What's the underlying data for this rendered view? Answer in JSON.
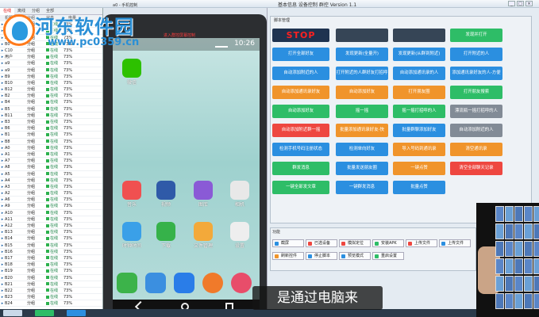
{
  "window": {
    "title": "基本信息  设备控制  群控  Version 1.1"
  },
  "watermark": {
    "title": "河东软件园",
    "url": "www.pc0359.cn"
  },
  "left": {
    "tabs": [
      "在线",
      "离线",
      "分组",
      "全部"
    ],
    "headers": [
      "",
      "机器名",
      "分组",
      "状态",
      "电量"
    ],
    "rows": [
      {
        "name": "a0",
        "group": "分组",
        "status": "在线",
        "batt": "73%"
      },
      {
        "name": "a9",
        "group": "分组",
        "status": "在线",
        "batt": "73%"
      },
      {
        "name": "a9",
        "group": "分组",
        "status": "在线",
        "batt": "73%"
      },
      {
        "name": "B0",
        "group": "分组",
        "status": "在线",
        "batt": "73%"
      },
      {
        "name": "C10",
        "group": "分组",
        "status": "在线",
        "batt": "73%"
      },
      {
        "name": "用户",
        "group": "分组",
        "status": "在线",
        "batt": "73%"
      },
      {
        "name": "a9",
        "group": "分组",
        "status": "在线",
        "batt": "73%"
      },
      {
        "name": "a9",
        "group": "分组",
        "status": "在线",
        "batt": "73%"
      },
      {
        "name": "B9",
        "group": "分组",
        "status": "在线",
        "batt": "73%"
      },
      {
        "name": "B10",
        "group": "分组",
        "status": "在线",
        "batt": "73%"
      },
      {
        "name": "B12",
        "group": "分组",
        "status": "在线",
        "batt": "73%"
      },
      {
        "name": "B2",
        "group": "分组",
        "status": "在线",
        "batt": "73%"
      },
      {
        "name": "B4",
        "group": "分组",
        "status": "在线",
        "batt": "73%"
      },
      {
        "name": "B5",
        "group": "分组",
        "status": "在线",
        "batt": "73%"
      },
      {
        "name": "B11",
        "group": "分组",
        "status": "在线",
        "batt": "73%"
      },
      {
        "name": "B3",
        "group": "分组",
        "status": "在线",
        "batt": "73%"
      },
      {
        "name": "B6",
        "group": "分组",
        "status": "在线",
        "batt": "73%"
      },
      {
        "name": "B1",
        "group": "分组",
        "status": "在线",
        "batt": "73%"
      },
      {
        "name": "B8",
        "group": "分组",
        "status": "在线",
        "batt": "73%"
      },
      {
        "name": "A0",
        "group": "分组",
        "status": "在线",
        "batt": "73%"
      },
      {
        "name": "A1",
        "group": "分组",
        "status": "在线",
        "batt": "73%"
      },
      {
        "name": "A7",
        "group": "分组",
        "status": "在线",
        "batt": "73%"
      },
      {
        "name": "A8",
        "group": "分组",
        "status": "在线",
        "batt": "73%"
      },
      {
        "name": "A5",
        "group": "分组",
        "status": "在线",
        "batt": "73%"
      },
      {
        "name": "A4",
        "group": "分组",
        "status": "在线",
        "batt": "73%"
      },
      {
        "name": "A3",
        "group": "分组",
        "status": "在线",
        "batt": "73%"
      },
      {
        "name": "A2",
        "group": "分组",
        "status": "在线",
        "batt": "73%"
      },
      {
        "name": "A6",
        "group": "分组",
        "status": "在线",
        "batt": "73%"
      },
      {
        "name": "A9",
        "group": "分组",
        "status": "在线",
        "batt": "73%"
      },
      {
        "name": "A10",
        "group": "分组",
        "status": "在线",
        "batt": "73%"
      },
      {
        "name": "A11",
        "group": "分组",
        "status": "在线",
        "batt": "73%"
      },
      {
        "name": "A12",
        "group": "分组",
        "status": "在线",
        "batt": "73%"
      },
      {
        "name": "B13",
        "group": "分组",
        "status": "在线",
        "batt": "73%"
      },
      {
        "name": "B14",
        "group": "分组",
        "status": "在线",
        "batt": "73%"
      },
      {
        "name": "B15",
        "group": "分组",
        "status": "在线",
        "batt": "73%"
      },
      {
        "name": "B16",
        "group": "分组",
        "status": "在线",
        "batt": "73%"
      },
      {
        "name": "B17",
        "group": "分组",
        "status": "在线",
        "batt": "73%"
      },
      {
        "name": "B18",
        "group": "分组",
        "status": "在线",
        "batt": "73%"
      },
      {
        "name": "B19",
        "group": "分组",
        "status": "在线",
        "batt": "73%"
      },
      {
        "name": "B20",
        "group": "分组",
        "status": "在线",
        "batt": "73%"
      },
      {
        "name": "B21",
        "group": "分组",
        "status": "在线",
        "batt": "73%"
      },
      {
        "name": "B22",
        "group": "分组",
        "status": "在线",
        "batt": "73%"
      },
      {
        "name": "B23",
        "group": "分组",
        "status": "在线",
        "batt": "73%"
      },
      {
        "name": "B24",
        "group": "分组",
        "status": "在线",
        "batt": "73%"
      }
    ]
  },
  "phone": {
    "window_label": "a0 - 手机控制",
    "red_label": "进入群控屏幕控制",
    "time": "10:26",
    "apps": [
      {
        "label": "微信",
        "color": "#2dc100",
        "icon": "wechat-icon"
      },
      {
        "label": "音乐",
        "color": "#f05050",
        "icon": "music-icon"
      },
      {
        "label": "视频",
        "color": "#2f5aa8",
        "icon": "video-icon"
      },
      {
        "label": "图库",
        "color": "#8a5ad6",
        "icon": "gallery-icon"
      },
      {
        "label": "相机",
        "color": "#e8e8e8",
        "icon": "camera-icon"
      },
      {
        "label": "时钟时间",
        "color": "#3aa0e8",
        "icon": "clock-icon"
      },
      {
        "label": "下载",
        "color": "#36b24a",
        "icon": "download-icon"
      },
      {
        "label": "文件管理",
        "color": "#f3a93a",
        "icon": "folder-icon"
      },
      {
        "label": "设置",
        "color": "#eeeeee",
        "icon": "settings-icon"
      }
    ],
    "dock": [
      {
        "color": "#3cb34a",
        "icon": "phone-icon"
      },
      {
        "color": "#3b8fe0",
        "icon": "contacts-icon"
      },
      {
        "color": "#2a7de8",
        "icon": "apps-grid-icon"
      },
      {
        "color": "#f07a2a",
        "icon": "messages-icon"
      },
      {
        "color": "#e84d6a",
        "icon": "browser-icon"
      }
    ]
  },
  "panel": {
    "caption": "脚本管理",
    "stop": "STOP",
    "buttons": [
      "发现并打开",
      "打开全部好友",
      "发现更新(全量开)",
      "发现更新(从群到附近)",
      "打开附近的人",
      "自动添加附近的人",
      "打开附近的人群好友打招呼",
      "自动添加通讯录的人",
      "添加通讯录好友的人-方便",
      "自动添加通讯录好友",
      "自动添加好友",
      "打开朋友圈",
      "打开朋友搜索",
      "自动添加好友",
      "摇一摇",
      "摇一摇打招呼的人",
      "漂流瓶一摇打招呼的人",
      "自动添加附近群一摇",
      "批量添加通讯录好友-快",
      "批量群聊添加好友",
      "自动添加附近的人",
      "检测手机号码注册状态",
      "检测单向好友",
      "导入号码到通讯录",
      "清空通讯录",
      "群发消息",
      "批量发送朋友圈",
      "一键点赞",
      "清空全部聊天记录",
      "一键全部发文章",
      "一键群发消息",
      "批量点赞",
      "批量打开朋友",
      "批量提取好友用户"
    ]
  },
  "bottom": {
    "caption": "功能",
    "buttons": [
      "截屏",
      "已选设备",
      "模拟定位",
      "安装APK",
      "上传文件",
      "上传文件",
      "刷新控件",
      "停止脚本",
      "预览模式",
      "重启设置"
    ]
  },
  "subtitle": "是通过电脑来",
  "colors": {
    "green": "#2ebd67",
    "blue": "#2b8fe0",
    "red": "#ee4740",
    "orange": "#f0942b",
    "gray": "#828b96",
    "dark": "#364556"
  }
}
